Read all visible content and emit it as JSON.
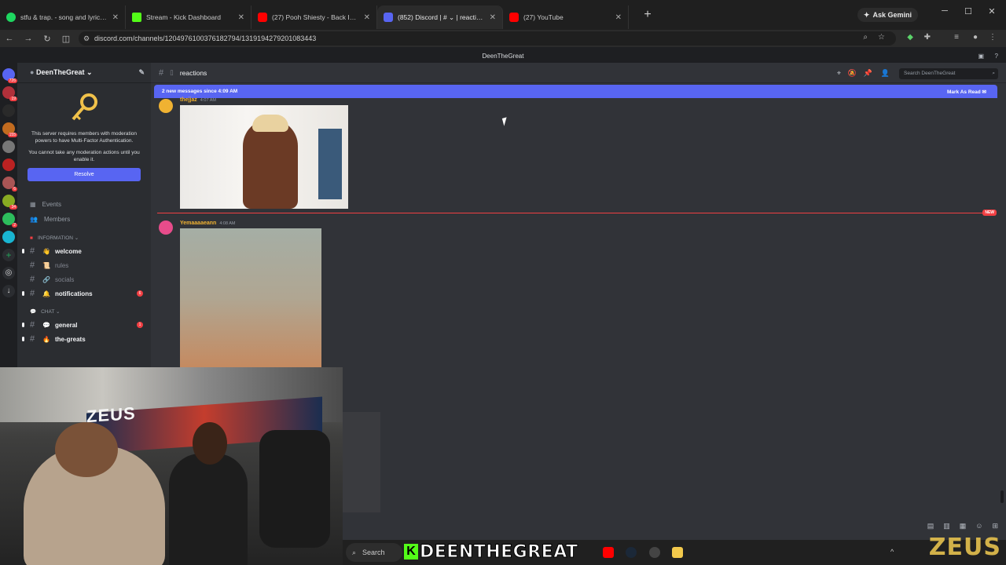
{
  "browser": {
    "tabs": [
      {
        "title": "stfu & trap. - song and lyrics by",
        "color": "#1ed760"
      },
      {
        "title": "Stream - Kick Dashboard",
        "color": "#53fc18"
      },
      {
        "title": "(27) Pooh Shiesty - Back In Blo",
        "color": "#ff0000"
      },
      {
        "title": "(852) Discord | # ⌄ | reactions",
        "color": "#5865f2"
      },
      {
        "title": "(27) YouTube",
        "color": "#ff0000"
      }
    ],
    "new_tab": "+",
    "gemini": "Ask Gemini",
    "url": "discord.com/channels/1204976100376182794/1319194279201083443"
  },
  "discord": {
    "top_title": "DeenTheGreat",
    "server": {
      "name": "DeenTheGreat",
      "mfa_text": "This server requires members with moderation powers to have Multi-Factor Authentication.",
      "mfa_sub": "You cannot take any moderation actions until you enable it.",
      "resolve": "Resolve",
      "events": "Events",
      "members": "Members",
      "cat_info": "INFORMATION ⌄",
      "cat_chat": "CHAT ⌄",
      "channels_info": [
        {
          "name": "welcome",
          "emoji": "👋",
          "unread": true
        },
        {
          "name": "rules",
          "emoji": "📜",
          "unread": false
        },
        {
          "name": "socials",
          "emoji": "🔗",
          "unread": false
        },
        {
          "name": "notifications",
          "emoji": "🔔",
          "unread": true,
          "count": "6"
        }
      ],
      "channels_chat": [
        {
          "name": "general",
          "emoji": "💬",
          "unread": true,
          "count": "1"
        },
        {
          "name": "the-greats",
          "emoji": "🔥",
          "unread": true
        }
      ]
    },
    "rail": {
      "badges": [
        "726",
        "19",
        "",
        "155",
        "",
        "",
        "",
        "6",
        "34",
        "2",
        "",
        "",
        ""
      ]
    },
    "channel": {
      "name": "reactions",
      "search_placeholder": "Search DeenTheGreat",
      "new_messages": "2 new messages since 4:09 AM",
      "mark_read": "Mark As Read",
      "new_tag": "NEW",
      "messages": [
        {
          "user": "thejjaz",
          "time": "4:07 AM",
          "color": "#f0b232"
        },
        {
          "user": "Yemaaaaeann",
          "time": "4:08 AM",
          "color": "#f0b232"
        }
      ]
    }
  },
  "stream_overlay": {
    "name": "DEENTHEGREAT",
    "kick_letter": "K",
    "watermark": "ZEUS",
    "cam_caption": "ZEUS"
  },
  "taskbar": {
    "search": "Search"
  }
}
